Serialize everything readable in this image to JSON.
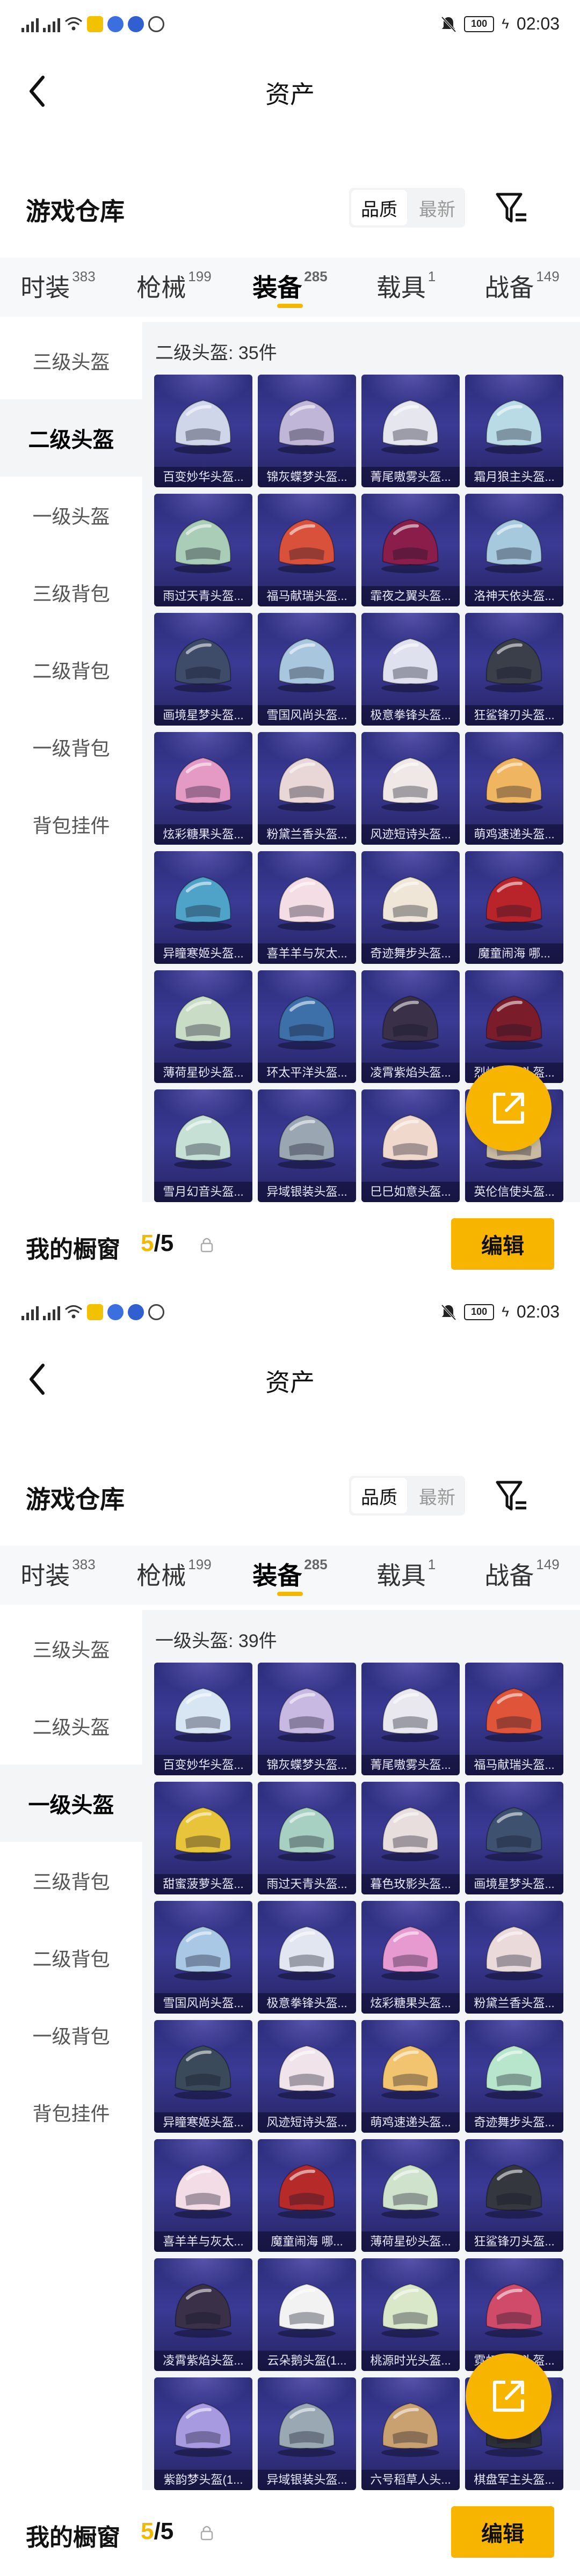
{
  "screens": [
    {
      "status": {
        "time": "02:03",
        "battery": "100"
      },
      "header": {
        "title": "资产"
      },
      "warehouse": {
        "title": "游戏仓库",
        "sort_options": [
          "品质",
          "最新"
        ],
        "sort_active": 0
      },
      "tabs": [
        {
          "label": "时装",
          "count": "383"
        },
        {
          "label": "枪械",
          "count": "199"
        },
        {
          "label": "装备",
          "count": "285"
        },
        {
          "label": "载具",
          "count": "1"
        },
        {
          "label": "战备",
          "count": "149"
        }
      ],
      "active_tab": 2,
      "sidebar": [
        "三级头盔",
        "二级头盔",
        "一级头盔",
        "三级背包",
        "二级背包",
        "一级背包",
        "背包挂件"
      ],
      "active_sidebar": 1,
      "section_label": "二级头盔: 35件",
      "items": [
        {
          "name": "百变妙华头盔...",
          "color": "#cfd6ea"
        },
        {
          "name": "锦灰蝶梦头盔...",
          "color": "#bfb6d8"
        },
        {
          "name": "菁尾嗷雾头盔...",
          "color": "#e6e6ee"
        },
        {
          "name": "霜月狼主头盔...",
          "color": "#b9dbe6"
        },
        {
          "name": "雨过天青头盔...",
          "color": "#a9cdb6"
        },
        {
          "name": "福马献瑞头盔...",
          "color": "#d9513a"
        },
        {
          "name": "霏夜之翼头盔...",
          "color": "#8a1d4a"
        },
        {
          "name": "洛神天依头盔...",
          "color": "#a6c9de"
        },
        {
          "name": "画境星梦头盔...",
          "color": "#3e4c6a"
        },
        {
          "name": "雪国风尚头盔...",
          "color": "#a8c6de"
        },
        {
          "name": "极意拳锋头盔...",
          "color": "#dfe2ee"
        },
        {
          "name": "狂鲨锋刃头盔...",
          "color": "#3a3f4a"
        },
        {
          "name": "炫彩糖果头盔...",
          "color": "#e59ac6"
        },
        {
          "name": "粉黛兰香头盔...",
          "color": "#e9d6d6"
        },
        {
          "name": "风迹短诗头盔...",
          "color": "#efe8e6"
        },
        {
          "name": "萌鸡速递头盔...",
          "color": "#f0b560"
        },
        {
          "name": "异瞳寒姬头盔...",
          "color": "#4fa3c8"
        },
        {
          "name": "喜羊羊与灰太...",
          "color": "#f4dde4"
        },
        {
          "name": "奇迹舞步头盔...",
          "color": "#f0e6d8"
        },
        {
          "name": "魔童闹海 哪...",
          "color": "#b8242a"
        },
        {
          "name": "薄荷星砂头盔...",
          "color": "#c9dcc6"
        },
        {
          "name": "环太平洋头盔...",
          "color": "#3d6fa8"
        },
        {
          "name": "凌霄紫焰头盔...",
          "color": "#3a3148"
        },
        {
          "name": "烈焰紫焰头盔...",
          "color": "#7a1c2a"
        },
        {
          "name": "雪月幻音头盔...",
          "color": "#c6e0d6"
        },
        {
          "name": "异域银装头盔...",
          "color": "#9aa6b2"
        },
        {
          "name": "巳巳如意头盔...",
          "color": "#f0d8cc"
        },
        {
          "name": "英伦信使头盔...",
          "color": "#c8b9a0"
        }
      ],
      "bottom": {
        "title": "我的橱窗",
        "count_current": "5",
        "count_total": "5",
        "edit_label": "编辑"
      }
    },
    {
      "status": {
        "time": "02:03",
        "battery": "100"
      },
      "header": {
        "title": "资产"
      },
      "warehouse": {
        "title": "游戏仓库",
        "sort_options": [
          "品质",
          "最新"
        ],
        "sort_active": 0
      },
      "tabs": [
        {
          "label": "时装",
          "count": "383"
        },
        {
          "label": "枪械",
          "count": "199"
        },
        {
          "label": "装备",
          "count": "285"
        },
        {
          "label": "载具",
          "count": "1"
        },
        {
          "label": "战备",
          "count": "149"
        }
      ],
      "active_tab": 2,
      "sidebar": [
        "三级头盔",
        "二级头盔",
        "一级头盔",
        "三级背包",
        "二级背包",
        "一级背包",
        "背包挂件"
      ],
      "active_sidebar": 2,
      "section_label": "一级头盔: 39件",
      "items": [
        {
          "name": "百变妙华头盔...",
          "color": "#d8e6f4"
        },
        {
          "name": "锦灰蝶梦头盔...",
          "color": "#c7b9e2"
        },
        {
          "name": "菁尾嗷雾头盔...",
          "color": "#e8e8ee"
        },
        {
          "name": "福马献瑞头盔...",
          "color": "#e0553a"
        },
        {
          "name": "甜蜜菠萝头盔...",
          "color": "#e8c43a"
        },
        {
          "name": "雨过天青头盔...",
          "color": "#a8d0c2"
        },
        {
          "name": "暮色玫影头盔...",
          "color": "#e8dede"
        },
        {
          "name": "画境星梦头盔...",
          "color": "#3e5270"
        },
        {
          "name": "雪国风尚头盔...",
          "color": "#a9c8e6"
        },
        {
          "name": "极意拳锋头盔...",
          "color": "#e2e6f0"
        },
        {
          "name": "炫彩糖果头盔...",
          "color": "#e79ad0"
        },
        {
          "name": "粉黛兰香头盔...",
          "color": "#eadada"
        },
        {
          "name": "异瞳寒姬头盔...",
          "color": "#3a4a5a"
        },
        {
          "name": "风迹短诗头盔...",
          "color": "#f0e4ea"
        },
        {
          "name": "萌鸡速递头盔...",
          "color": "#f2c470"
        },
        {
          "name": "奇迹舞步头盔...",
          "color": "#b8e6cc"
        },
        {
          "name": "喜羊羊与灰太...",
          "color": "#f4dce6"
        },
        {
          "name": "魔童闹海 哪...",
          "color": "#b62a2a"
        },
        {
          "name": "薄荷星砂头盔...",
          "color": "#cfe2cc"
        },
        {
          "name": "狂鲨锋刃头盔...",
          "color": "#34383e"
        },
        {
          "name": "凌霄紫焰头盔...",
          "color": "#3a3048"
        },
        {
          "name": "云朵鹅头盔(1...",
          "color": "#f2f2f2"
        },
        {
          "name": "桃源时光头盔...",
          "color": "#d9e8c8"
        },
        {
          "name": "霓虹光影头盔...",
          "color": "#d04a6a"
        },
        {
          "name": "紫韵梦头盔(1...",
          "color": "#a89ae0"
        },
        {
          "name": "异域银装头盔...",
          "color": "#9aa8b4"
        },
        {
          "name": "六号稻草人头...",
          "color": "#c9a070"
        },
        {
          "name": "棋盘军主头盔...",
          "color": "#2e3038"
        }
      ],
      "bottom": {
        "title": "我的橱窗",
        "count_current": "5",
        "count_total": "5",
        "edit_label": "编辑"
      }
    }
  ],
  "colors": {
    "accent": "#f7b500",
    "card_bg": "#2c2d7a",
    "panel_bg": "#f4f5f7"
  },
  "icons": {
    "back": "chevron-left-icon",
    "filter": "filter-icon",
    "share": "share-out-icon",
    "lock": "lock-icon"
  }
}
